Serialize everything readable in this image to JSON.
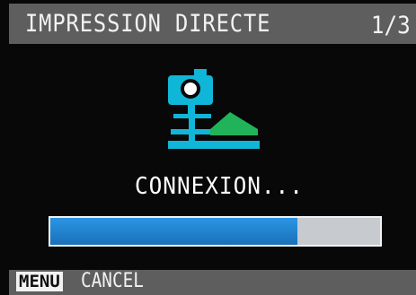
{
  "header": {
    "title": "IMPRESSION DIRECTE",
    "page": "1/3"
  },
  "main": {
    "status": "CONNEXION...",
    "progress_fraction": 0.75,
    "icon": "camera-printer-connection-icon"
  },
  "footer": {
    "menu_label": "MENU",
    "cancel_label": "CANCEL"
  },
  "colors": {
    "background": "#080808",
    "header_bar": "#5e5e5e",
    "text": "#f2f2f2",
    "icon_cyan": "#10b6d8",
    "icon_green": "#21b35a",
    "progress_fill": "#1f86d2",
    "progress_track": "#c7cacf"
  }
}
